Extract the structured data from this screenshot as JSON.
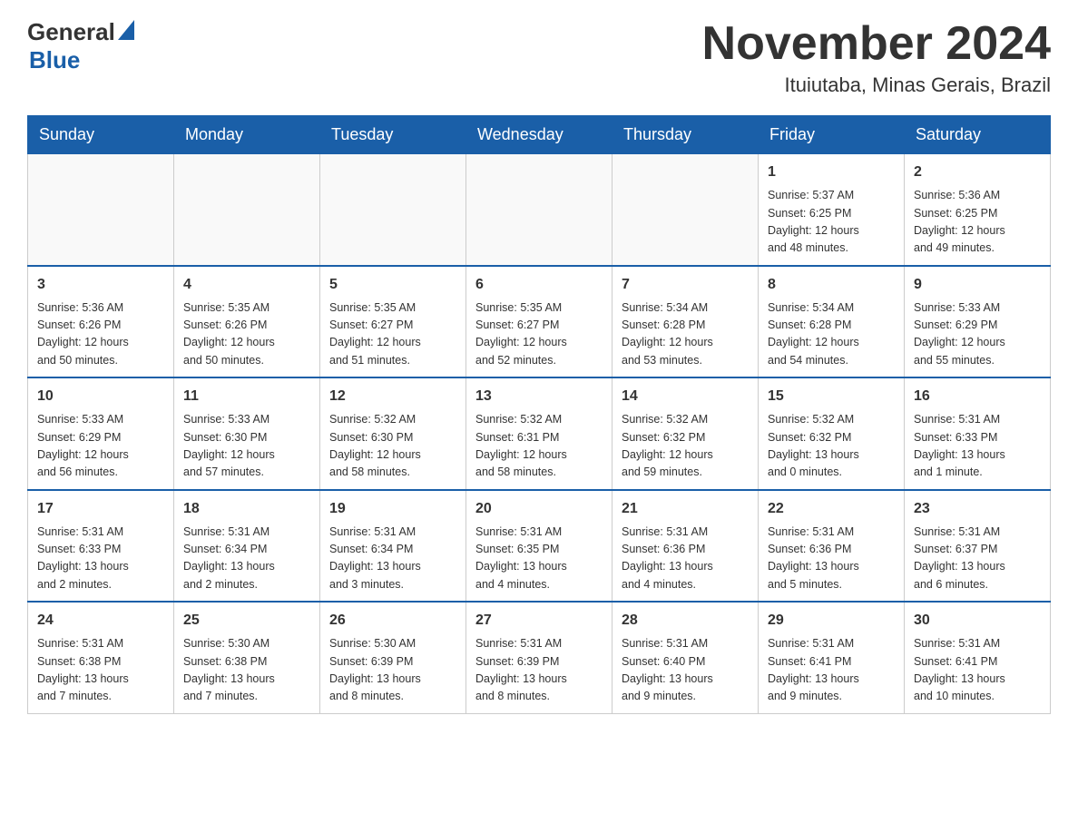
{
  "logo": {
    "general": "General",
    "blue": "Blue"
  },
  "title": "November 2024",
  "subtitle": "Ituiutaba, Minas Gerais, Brazil",
  "days_of_week": [
    "Sunday",
    "Monday",
    "Tuesday",
    "Wednesday",
    "Thursday",
    "Friday",
    "Saturday"
  ],
  "weeks": [
    [
      {
        "day": "",
        "info": ""
      },
      {
        "day": "",
        "info": ""
      },
      {
        "day": "",
        "info": ""
      },
      {
        "day": "",
        "info": ""
      },
      {
        "day": "",
        "info": ""
      },
      {
        "day": "1",
        "info": "Sunrise: 5:37 AM\nSunset: 6:25 PM\nDaylight: 12 hours\nand 48 minutes."
      },
      {
        "day": "2",
        "info": "Sunrise: 5:36 AM\nSunset: 6:25 PM\nDaylight: 12 hours\nand 49 minutes."
      }
    ],
    [
      {
        "day": "3",
        "info": "Sunrise: 5:36 AM\nSunset: 6:26 PM\nDaylight: 12 hours\nand 50 minutes."
      },
      {
        "day": "4",
        "info": "Sunrise: 5:35 AM\nSunset: 6:26 PM\nDaylight: 12 hours\nand 50 minutes."
      },
      {
        "day": "5",
        "info": "Sunrise: 5:35 AM\nSunset: 6:27 PM\nDaylight: 12 hours\nand 51 minutes."
      },
      {
        "day": "6",
        "info": "Sunrise: 5:35 AM\nSunset: 6:27 PM\nDaylight: 12 hours\nand 52 minutes."
      },
      {
        "day": "7",
        "info": "Sunrise: 5:34 AM\nSunset: 6:28 PM\nDaylight: 12 hours\nand 53 minutes."
      },
      {
        "day": "8",
        "info": "Sunrise: 5:34 AM\nSunset: 6:28 PM\nDaylight: 12 hours\nand 54 minutes."
      },
      {
        "day": "9",
        "info": "Sunrise: 5:33 AM\nSunset: 6:29 PM\nDaylight: 12 hours\nand 55 minutes."
      }
    ],
    [
      {
        "day": "10",
        "info": "Sunrise: 5:33 AM\nSunset: 6:29 PM\nDaylight: 12 hours\nand 56 minutes."
      },
      {
        "day": "11",
        "info": "Sunrise: 5:33 AM\nSunset: 6:30 PM\nDaylight: 12 hours\nand 57 minutes."
      },
      {
        "day": "12",
        "info": "Sunrise: 5:32 AM\nSunset: 6:30 PM\nDaylight: 12 hours\nand 58 minutes."
      },
      {
        "day": "13",
        "info": "Sunrise: 5:32 AM\nSunset: 6:31 PM\nDaylight: 12 hours\nand 58 minutes."
      },
      {
        "day": "14",
        "info": "Sunrise: 5:32 AM\nSunset: 6:32 PM\nDaylight: 12 hours\nand 59 minutes."
      },
      {
        "day": "15",
        "info": "Sunrise: 5:32 AM\nSunset: 6:32 PM\nDaylight: 13 hours\nand 0 minutes."
      },
      {
        "day": "16",
        "info": "Sunrise: 5:31 AM\nSunset: 6:33 PM\nDaylight: 13 hours\nand 1 minute."
      }
    ],
    [
      {
        "day": "17",
        "info": "Sunrise: 5:31 AM\nSunset: 6:33 PM\nDaylight: 13 hours\nand 2 minutes."
      },
      {
        "day": "18",
        "info": "Sunrise: 5:31 AM\nSunset: 6:34 PM\nDaylight: 13 hours\nand 2 minutes."
      },
      {
        "day": "19",
        "info": "Sunrise: 5:31 AM\nSunset: 6:34 PM\nDaylight: 13 hours\nand 3 minutes."
      },
      {
        "day": "20",
        "info": "Sunrise: 5:31 AM\nSunset: 6:35 PM\nDaylight: 13 hours\nand 4 minutes."
      },
      {
        "day": "21",
        "info": "Sunrise: 5:31 AM\nSunset: 6:36 PM\nDaylight: 13 hours\nand 4 minutes."
      },
      {
        "day": "22",
        "info": "Sunrise: 5:31 AM\nSunset: 6:36 PM\nDaylight: 13 hours\nand 5 minutes."
      },
      {
        "day": "23",
        "info": "Sunrise: 5:31 AM\nSunset: 6:37 PM\nDaylight: 13 hours\nand 6 minutes."
      }
    ],
    [
      {
        "day": "24",
        "info": "Sunrise: 5:31 AM\nSunset: 6:38 PM\nDaylight: 13 hours\nand 7 minutes."
      },
      {
        "day": "25",
        "info": "Sunrise: 5:30 AM\nSunset: 6:38 PM\nDaylight: 13 hours\nand 7 minutes."
      },
      {
        "day": "26",
        "info": "Sunrise: 5:30 AM\nSunset: 6:39 PM\nDaylight: 13 hours\nand 8 minutes."
      },
      {
        "day": "27",
        "info": "Sunrise: 5:31 AM\nSunset: 6:39 PM\nDaylight: 13 hours\nand 8 minutes."
      },
      {
        "day": "28",
        "info": "Sunrise: 5:31 AM\nSunset: 6:40 PM\nDaylight: 13 hours\nand 9 minutes."
      },
      {
        "day": "29",
        "info": "Sunrise: 5:31 AM\nSunset: 6:41 PM\nDaylight: 13 hours\nand 9 minutes."
      },
      {
        "day": "30",
        "info": "Sunrise: 5:31 AM\nSunset: 6:41 PM\nDaylight: 13 hours\nand 10 minutes."
      }
    ]
  ]
}
